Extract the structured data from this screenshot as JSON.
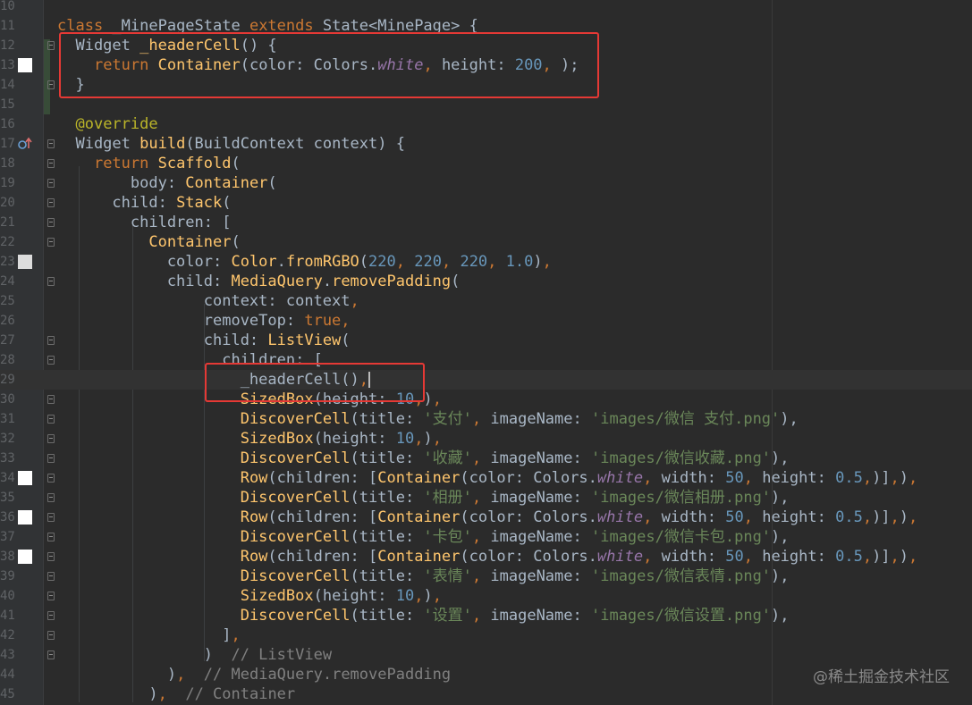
{
  "editor": {
    "lines": [
      {
        "num": "10",
        "tokens": []
      },
      {
        "num": "11",
        "tokens": [
          [
            "k",
            "class "
          ],
          [
            "",
            "_MinePageState "
          ],
          [
            "k",
            "extends "
          ],
          [
            "",
            "State<MinePage> {"
          ]
        ]
      },
      {
        "num": "12",
        "tokens": [
          [
            "",
            "  Widget "
          ],
          [
            "t",
            "_headerCell"
          ],
          [
            "",
            "() {"
          ]
        ]
      },
      {
        "num": "13",
        "tokens": [
          [
            "",
            "    "
          ],
          [
            "k",
            "return "
          ],
          [
            "t",
            "Container"
          ],
          [
            "",
            "(color: Colors."
          ],
          [
            "p",
            "white"
          ],
          [
            "k",
            ", "
          ],
          [
            "",
            "height: "
          ],
          [
            "n",
            "200"
          ],
          [
            "k",
            ", "
          ],
          [
            "",
            ");"
          ]
        ]
      },
      {
        "num": "14",
        "tokens": [
          [
            "",
            "  }"
          ]
        ]
      },
      {
        "num": "15",
        "tokens": []
      },
      {
        "num": "16",
        "tokens": [
          [
            "",
            "  "
          ],
          [
            "a",
            "@override"
          ]
        ]
      },
      {
        "num": "17",
        "tokens": [
          [
            "",
            "  Widget "
          ],
          [
            "t",
            "build"
          ],
          [
            "",
            "(BuildContext context) {"
          ]
        ]
      },
      {
        "num": "18",
        "tokens": [
          [
            "",
            "    "
          ],
          [
            "k",
            "return "
          ],
          [
            "t",
            "Scaffold"
          ],
          [
            "",
            "("
          ]
        ]
      },
      {
        "num": "19",
        "tokens": [
          [
            "",
            "        body: "
          ],
          [
            "t",
            "Container"
          ],
          [
            "",
            "("
          ]
        ]
      },
      {
        "num": "20",
        "tokens": [
          [
            "",
            "      child: "
          ],
          [
            "t",
            "Stack"
          ],
          [
            "",
            "("
          ]
        ]
      },
      {
        "num": "21",
        "tokens": [
          [
            "",
            "        children: ["
          ]
        ]
      },
      {
        "num": "22",
        "tokens": [
          [
            "",
            "          "
          ],
          [
            "t",
            "Container"
          ],
          [
            "",
            "("
          ]
        ]
      },
      {
        "num": "23",
        "tokens": [
          [
            "",
            "            color: "
          ],
          [
            "t",
            "Color"
          ],
          [
            "",
            "."
          ],
          [
            "t",
            "fromRGBO"
          ],
          [
            "",
            "("
          ],
          [
            "n",
            "220"
          ],
          [
            "k",
            ", "
          ],
          [
            "n",
            "220"
          ],
          [
            "k",
            ", "
          ],
          [
            "n",
            "220"
          ],
          [
            "k",
            ", "
          ],
          [
            "n",
            "1.0"
          ],
          [
            "",
            ")"
          ],
          [
            "k",
            ","
          ]
        ]
      },
      {
        "num": "24",
        "tokens": [
          [
            "",
            "            child: "
          ],
          [
            "t",
            "MediaQuery"
          ],
          [
            "",
            "."
          ],
          [
            "t",
            "removePadding"
          ],
          [
            "",
            "("
          ]
        ]
      },
      {
        "num": "25",
        "tokens": [
          [
            "",
            "                context: context"
          ],
          [
            "k",
            ","
          ]
        ]
      },
      {
        "num": "26",
        "tokens": [
          [
            "",
            "                removeTop: "
          ],
          [
            "k",
            "true,"
          ]
        ]
      },
      {
        "num": "27",
        "tokens": [
          [
            "",
            "                child: "
          ],
          [
            "t",
            "ListView"
          ],
          [
            "",
            "("
          ]
        ]
      },
      {
        "num": "28",
        "tokens": [
          [
            "",
            "                  children: ["
          ]
        ]
      },
      {
        "num": "29",
        "tokens": [
          [
            "",
            "                    _headerCell()"
          ],
          [
            "k",
            ","
          ]
        ],
        "caret": true
      },
      {
        "num": "30",
        "tokens": [
          [
            "",
            "                    "
          ],
          [
            "t",
            "SizedBox"
          ],
          [
            "",
            "(height: "
          ],
          [
            "n",
            "10"
          ],
          [
            "k",
            ","
          ],
          [
            "",
            ")"
          ],
          [
            "k",
            ","
          ]
        ]
      },
      {
        "num": "31",
        "tokens": [
          [
            "",
            "                    "
          ],
          [
            "t",
            "DiscoverCell"
          ],
          [
            "",
            "(title: "
          ],
          [
            "s",
            "'支付'"
          ],
          [
            "k",
            ", "
          ],
          [
            "",
            "imageName: "
          ],
          [
            "s",
            "'images/微信 支付.png'"
          ],
          [
            "",
            "),"
          ]
        ]
      },
      {
        "num": "32",
        "tokens": [
          [
            "",
            "                    "
          ],
          [
            "t",
            "SizedBox"
          ],
          [
            "",
            "(height: "
          ],
          [
            "n",
            "10"
          ],
          [
            "k",
            ","
          ],
          [
            "",
            ")"
          ],
          [
            "k",
            ","
          ]
        ]
      },
      {
        "num": "33",
        "tokens": [
          [
            "",
            "                    "
          ],
          [
            "t",
            "DiscoverCell"
          ],
          [
            "",
            "(title: "
          ],
          [
            "s",
            "'收藏'"
          ],
          [
            "k",
            ", "
          ],
          [
            "",
            "imageName: "
          ],
          [
            "s",
            "'images/微信收藏.png'"
          ],
          [
            "",
            "),"
          ]
        ]
      },
      {
        "num": "34",
        "tokens": [
          [
            "",
            "                    "
          ],
          [
            "t",
            "Row"
          ],
          [
            "",
            "(children: ["
          ],
          [
            "t",
            "Container"
          ],
          [
            "",
            "(color: Colors."
          ],
          [
            "p",
            "white"
          ],
          [
            "k",
            ", "
          ],
          [
            "",
            "width: "
          ],
          [
            "n",
            "50"
          ],
          [
            "k",
            ", "
          ],
          [
            "",
            "height: "
          ],
          [
            "n",
            "0.5"
          ],
          [
            "k",
            ","
          ],
          [
            "",
            ")]"
          ],
          [
            "k",
            ","
          ],
          [
            "",
            ")"
          ],
          [
            "k",
            ","
          ]
        ]
      },
      {
        "num": "35",
        "tokens": [
          [
            "",
            "                    "
          ],
          [
            "t",
            "DiscoverCell"
          ],
          [
            "",
            "(title: "
          ],
          [
            "s",
            "'相册'"
          ],
          [
            "k",
            ", "
          ],
          [
            "",
            "imageName: "
          ],
          [
            "s",
            "'images/微信相册.png'"
          ],
          [
            "",
            "),"
          ]
        ]
      },
      {
        "num": "36",
        "tokens": [
          [
            "",
            "                    "
          ],
          [
            "t",
            "Row"
          ],
          [
            "",
            "(children: ["
          ],
          [
            "t",
            "Container"
          ],
          [
            "",
            "(color: Colors."
          ],
          [
            "p",
            "white"
          ],
          [
            "k",
            ", "
          ],
          [
            "",
            "width: "
          ],
          [
            "n",
            "50"
          ],
          [
            "k",
            ", "
          ],
          [
            "",
            "height: "
          ],
          [
            "n",
            "0.5"
          ],
          [
            "k",
            ","
          ],
          [
            "",
            ")]"
          ],
          [
            "k",
            ","
          ],
          [
            "",
            ")"
          ],
          [
            "k",
            ","
          ]
        ]
      },
      {
        "num": "37",
        "tokens": [
          [
            "",
            "                    "
          ],
          [
            "t",
            "DiscoverCell"
          ],
          [
            "",
            "(title: "
          ],
          [
            "s",
            "'卡包'"
          ],
          [
            "k",
            ", "
          ],
          [
            "",
            "imageName: "
          ],
          [
            "s",
            "'images/微信卡包.png'"
          ],
          [
            "",
            "),"
          ]
        ]
      },
      {
        "num": "38",
        "tokens": [
          [
            "",
            "                    "
          ],
          [
            "t",
            "Row"
          ],
          [
            "",
            "(children: ["
          ],
          [
            "t",
            "Container"
          ],
          [
            "",
            "(color: Colors."
          ],
          [
            "p",
            "white"
          ],
          [
            "k",
            ", "
          ],
          [
            "",
            "width: "
          ],
          [
            "n",
            "50"
          ],
          [
            "k",
            ", "
          ],
          [
            "",
            "height: "
          ],
          [
            "n",
            "0.5"
          ],
          [
            "k",
            ","
          ],
          [
            "",
            ")]"
          ],
          [
            "k",
            ","
          ],
          [
            "",
            ")"
          ],
          [
            "k",
            ","
          ]
        ]
      },
      {
        "num": "39",
        "tokens": [
          [
            "",
            "                    "
          ],
          [
            "t",
            "DiscoverCell"
          ],
          [
            "",
            "(title: "
          ],
          [
            "s",
            "'表情'"
          ],
          [
            "k",
            ", "
          ],
          [
            "",
            "imageName: "
          ],
          [
            "s",
            "'images/微信表情.png'"
          ],
          [
            "",
            "),"
          ]
        ]
      },
      {
        "num": "40",
        "tokens": [
          [
            "",
            "                    "
          ],
          [
            "t",
            "SizedBox"
          ],
          [
            "",
            "(height: "
          ],
          [
            "n",
            "10"
          ],
          [
            "k",
            ","
          ],
          [
            "",
            ")"
          ],
          [
            "k",
            ","
          ]
        ]
      },
      {
        "num": "41",
        "tokens": [
          [
            "",
            "                    "
          ],
          [
            "t",
            "DiscoverCell"
          ],
          [
            "",
            "(title: "
          ],
          [
            "s",
            "'设置'"
          ],
          [
            "k",
            ", "
          ],
          [
            "",
            "imageName: "
          ],
          [
            "s",
            "'images/微信设置.png'"
          ],
          [
            "",
            "),"
          ]
        ]
      },
      {
        "num": "42",
        "tokens": [
          [
            "",
            "                  ]"
          ],
          [
            "k",
            ","
          ]
        ]
      },
      {
        "num": "43",
        "tokens": [
          [
            "",
            "                )  "
          ],
          [
            "c",
            "// ListView"
          ]
        ]
      },
      {
        "num": "44",
        "tokens": [
          [
            "",
            "            )"
          ],
          [
            "k",
            ","
          ],
          [
            "",
            "  "
          ],
          [
            "c",
            "// MediaQuery.removePadding"
          ]
        ]
      },
      {
        "num": "45",
        "tokens": [
          [
            "",
            "          )"
          ],
          [
            "k",
            ","
          ],
          [
            "",
            "  "
          ],
          [
            "c",
            "// Container"
          ]
        ]
      }
    ],
    "gutter_icons": {
      "13": "white-color-swatch-icon",
      "17": "override-marker-icon",
      "23": "grey-color-swatch-icon",
      "34": "white-color-swatch-icon",
      "36": "white-color-swatch-icon",
      "38": "white-color-swatch-icon"
    },
    "fold_lines": [
      "12",
      "14",
      "17",
      "18",
      "19",
      "20",
      "21",
      "22",
      "24",
      "27",
      "28",
      "30",
      "31",
      "32",
      "33",
      "34",
      "35",
      "36",
      "37",
      "38",
      "39",
      "40",
      "41",
      "42",
      "43"
    ]
  },
  "watermark": "@稀土掘金技术社区",
  "colors": {
    "background": "#2b2b2b",
    "keyword": "#cc7832",
    "function": "#ffc66d",
    "string": "#6a8759",
    "number": "#6897bb",
    "property": "#9876aa",
    "annotation": "#bbb529",
    "comment": "#808080",
    "highlight_box": "#e53935"
  }
}
